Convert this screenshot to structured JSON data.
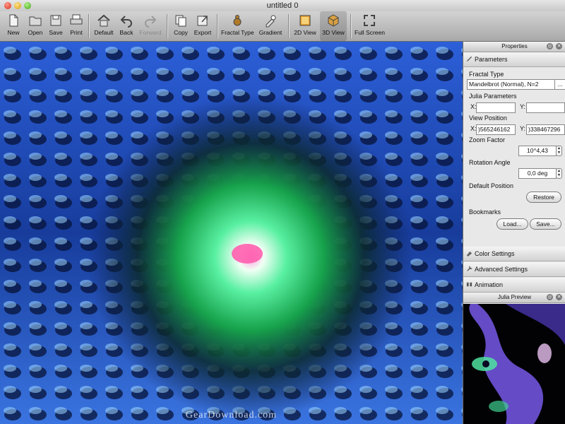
{
  "window": {
    "title": "untitled 0"
  },
  "toolbar": {
    "items": [
      {
        "label": "New",
        "icon": "new-file-icon"
      },
      {
        "label": "Open",
        "icon": "open-folder-icon"
      },
      {
        "label": "Save",
        "icon": "save-icon"
      },
      {
        "label": "Print",
        "icon": "print-icon"
      },
      {
        "label": "Default",
        "icon": "home-icon"
      },
      {
        "label": "Back",
        "icon": "back-arrow-icon"
      },
      {
        "label": "Forward",
        "icon": "forward-arrow-icon"
      },
      {
        "label": "Copy",
        "icon": "copy-icon"
      },
      {
        "label": "Export",
        "icon": "export-icon"
      },
      {
        "label": "Fractal Type",
        "icon": "fractal-type-icon"
      },
      {
        "label": "Gradient",
        "icon": "gradient-icon"
      },
      {
        "label": "2D View",
        "icon": "2d-view-icon"
      },
      {
        "label": "3D View",
        "icon": "3d-view-icon"
      },
      {
        "label": "Full Screen",
        "icon": "full-screen-icon"
      }
    ]
  },
  "viewport": {
    "watermark": "GearDownload.com"
  },
  "properties": {
    "title": "Properties",
    "parameters_header": "Parameters",
    "fractal_type_label": "Fractal Type",
    "fractal_type_value": "Mandelbrot (Normal), N=2",
    "fractal_type_more": "...",
    "julia_label": "Julia Parameters",
    "x_label": "X:",
    "y_label": "Y:",
    "julia_x": "",
    "julia_y": "",
    "view_position_label": "View Position",
    "view_x": ")565246162",
    "view_y": ")338467296",
    "zoom_label": "Zoom Factor",
    "zoom_value": "10^4,43",
    "rotation_label": "Rotation Angle",
    "rotation_value": "0,0 deg",
    "default_position_label": "Default Position",
    "restore_button": "Restore",
    "bookmarks_label": "Bookmarks",
    "load_button": "Load...",
    "save_button": "Save...",
    "color_settings_header": "Color Settings",
    "advanced_settings_header": "Advanced Settings",
    "animation_header": "Animation"
  },
  "julia_preview": {
    "title": "Julia Preview"
  }
}
